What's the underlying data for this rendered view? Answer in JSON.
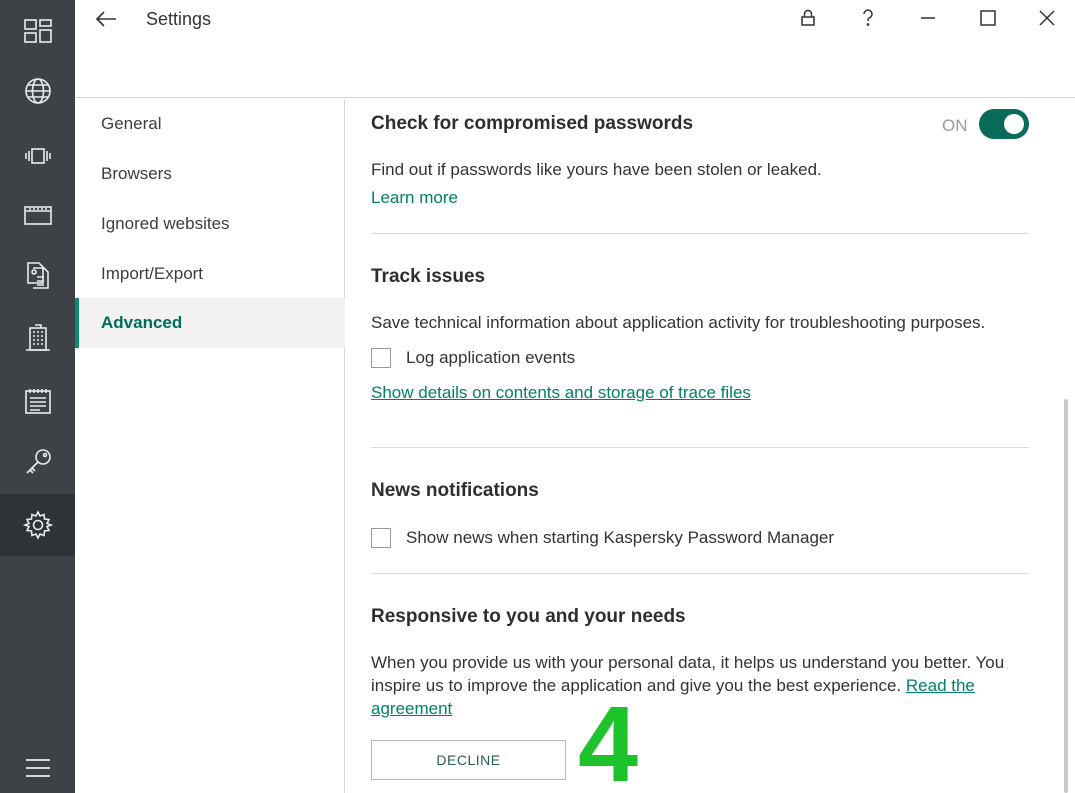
{
  "window": {
    "title": "Settings"
  },
  "rail": {
    "items": [
      {
        "icon": "dashboard-icon"
      },
      {
        "icon": "globe-icon"
      },
      {
        "icon": "apps-icon"
      },
      {
        "icon": "card-icon"
      },
      {
        "icon": "documents-icon"
      },
      {
        "icon": "building-icon"
      },
      {
        "icon": "notes-icon"
      },
      {
        "icon": "key-icon"
      },
      {
        "icon": "gear-icon"
      }
    ],
    "menu_icon": "hamburger-menu-icon",
    "active_index": 8
  },
  "nav": {
    "items": [
      {
        "label": "General"
      },
      {
        "label": "Browsers"
      },
      {
        "label": "Ignored websites"
      },
      {
        "label": "Import/Export"
      },
      {
        "label": "Advanced"
      }
    ],
    "active_index": 4
  },
  "sections": {
    "compromised": {
      "title": "Check for compromised passwords",
      "toggle_label": "ON",
      "toggle_on": true,
      "description": "Find out if passwords like yours have been stolen or leaked.",
      "link": "Learn more"
    },
    "track": {
      "title": "Track issues",
      "description": "Save technical information about application activity for troubleshooting purposes.",
      "checkbox_label": "Log application events",
      "checkbox_checked": false,
      "link": "Show details on contents and storage of trace files"
    },
    "news": {
      "title": "News notifications",
      "checkbox_label": "Show news when starting Kaspersky Password Manager",
      "checkbox_checked": false
    },
    "responsive": {
      "title": "Responsive to you and your needs",
      "description": "When you provide us with your personal data, it helps us understand you better. You inspire us to improve the application and give you the best experience.",
      "link_part1": "Read the",
      "link_part2": "agreement",
      "button_label": "DECLINE"
    }
  },
  "overlay": {
    "step_number": "4",
    "color": "#1ec32c"
  },
  "colors": {
    "accent": "#0b6b5a",
    "link": "#00806b",
    "rail": "#3e4247"
  }
}
